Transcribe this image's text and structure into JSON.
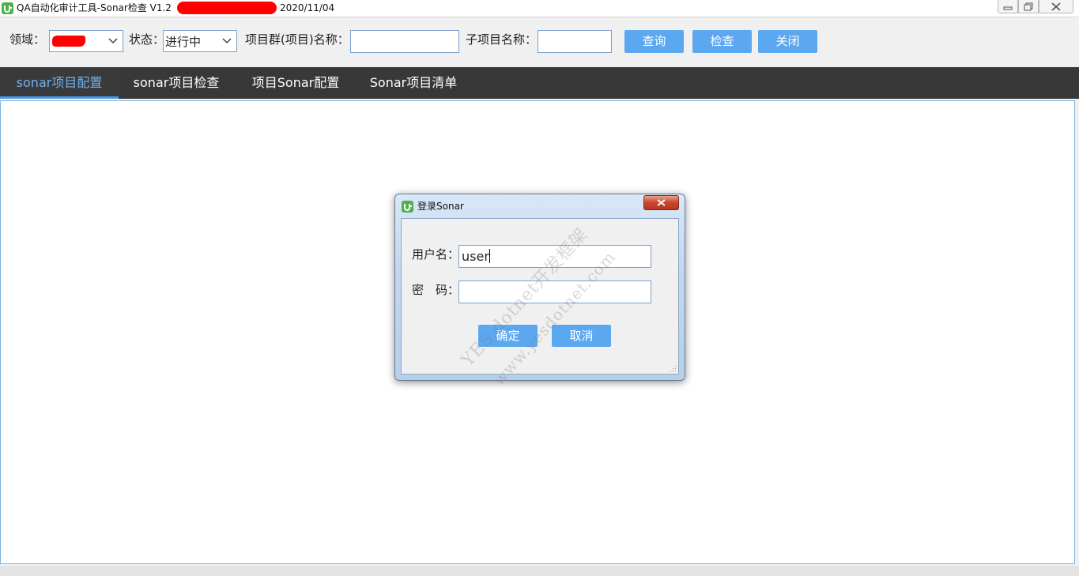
{
  "window": {
    "title": "QA自动化审计工具-Sonar检查 V1.2",
    "date": "2020/11/04"
  },
  "toolbar": {
    "domain_label": "领域：",
    "status_label": "状态：",
    "status_value": "进行中",
    "group_label": "项目群(项目)名称：",
    "group_value": "",
    "sub_label": "子项目名称：",
    "sub_value": "",
    "query_button": "查询",
    "check_button": "检查",
    "close_button": "关闭"
  },
  "tabs": [
    {
      "label": "sonar项目配置",
      "active": true
    },
    {
      "label": "sonar项目检查",
      "active": false
    },
    {
      "label": "项目Sonar配置",
      "active": false
    },
    {
      "label": "Sonar项目清单",
      "active": false
    }
  ],
  "dialog": {
    "title": "登录Sonar",
    "username_label": "用户名：",
    "username_value": "user",
    "password_label": "密　码：",
    "password_value": "",
    "ok_button": "确定",
    "cancel_button": "取消"
  },
  "watermark": {
    "line1": "YES.dotnet开发框架",
    "line2": "www.yesdotnet.com"
  },
  "colors": {
    "accent": "#5ca8f0",
    "tabbar": "#383838",
    "active_tab_text": "#6fb1f4",
    "redaction": "#ff0000"
  }
}
